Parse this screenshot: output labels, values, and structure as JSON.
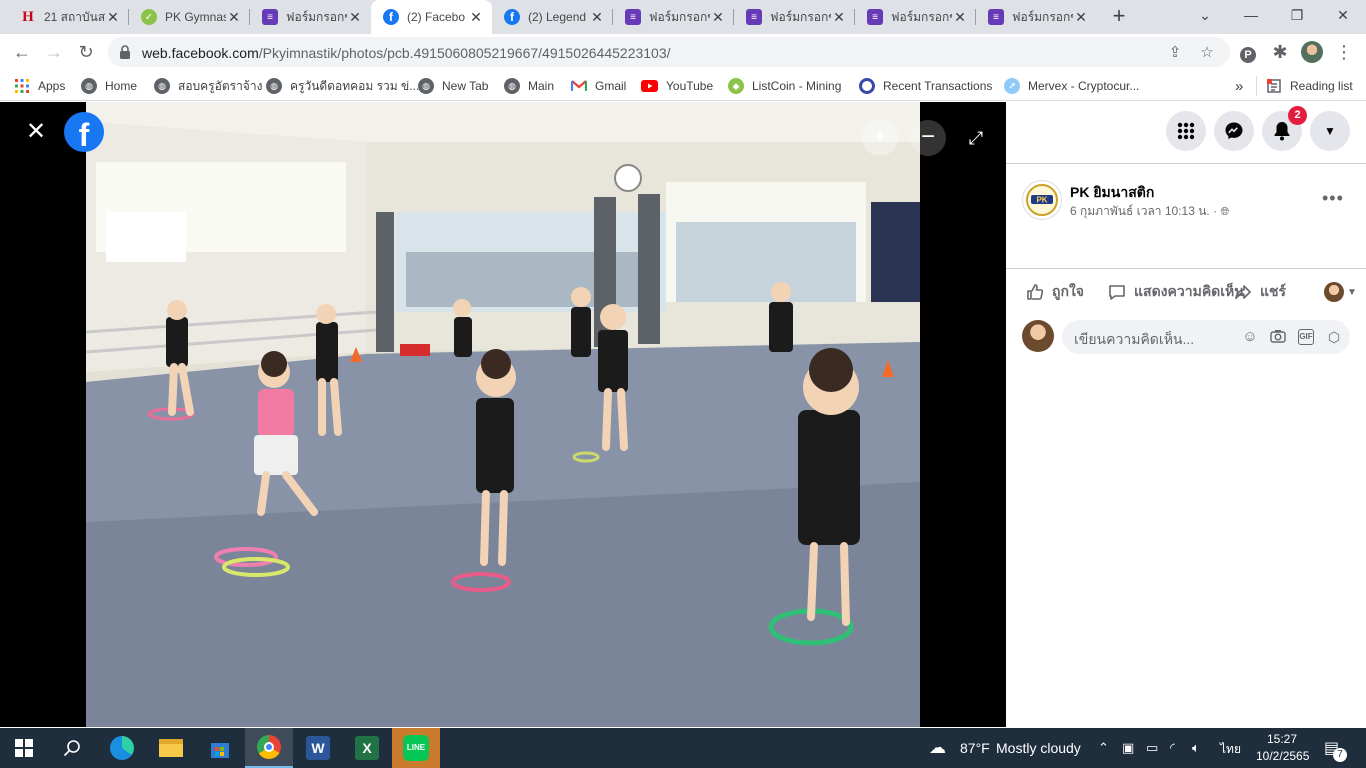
{
  "browser": {
    "tabs": [
      {
        "title": "21 สถาบันส",
        "favicon": "netflix-icon",
        "active": false
      },
      {
        "title": "PK Gymnas",
        "favicon": "pk-logo-icon",
        "active": false
      },
      {
        "title": "ฟอร์มกรอกข",
        "favicon": "forms-icon",
        "active": false
      },
      {
        "title": "(2) Facebo",
        "favicon": "facebook-icon",
        "active": true
      },
      {
        "title": "(2) Legend",
        "favicon": "facebook-icon",
        "active": false
      },
      {
        "title": "ฟอร์มกรอกข",
        "favicon": "forms-icon",
        "active": false
      },
      {
        "title": "ฟอร์มกรอกข",
        "favicon": "forms-icon",
        "active": false
      },
      {
        "title": "ฟอร์มกรอกข",
        "favicon": "forms-icon",
        "active": false
      },
      {
        "title": "ฟอร์มกรอกข",
        "favicon": "forms-icon",
        "active": false
      }
    ],
    "url_host": "web.facebook.com",
    "url_path": "/Pkyimnastik/photos/pcb.4915060805219667/4915026445223103/",
    "bookmarks": [
      {
        "label": "Apps",
        "icon": "apps-grid-icon"
      },
      {
        "label": "Home",
        "icon": "globe-icon"
      },
      {
        "label": "สอบครูอัตราจ้าง",
        "icon": "globe-icon"
      },
      {
        "label": "ครูวันดีดอทคอม รวม ข่...",
        "icon": "globe-icon"
      },
      {
        "label": "New Tab",
        "icon": "globe-icon"
      },
      {
        "label": "Main",
        "icon": "globe-icon"
      },
      {
        "label": "Gmail",
        "icon": "gmail-icon"
      },
      {
        "label": "YouTube",
        "icon": "youtube-icon"
      },
      {
        "label": "ListCoin - Mining",
        "icon": "listcoin-icon"
      },
      {
        "label": "Recent Transactions",
        "icon": "transactions-icon"
      },
      {
        "label": "Mervex - Cryptocur...",
        "icon": "mervex-icon"
      }
    ],
    "more_bookmarks": "»",
    "reading_list": "Reading list"
  },
  "viewer": {
    "close": "✕",
    "zoom_in": "+",
    "zoom_out": "−"
  },
  "post": {
    "page_name": "PK ยิมนาสติก",
    "date": "6 กุมภาพันธ์ เวลา 10:13 น. ·",
    "more": "•••",
    "notification_count": "2",
    "actions": {
      "like": "ถูกใจ",
      "comment": "แสดงความคิดเห็น",
      "share": "แชร์"
    },
    "comment_placeholder": "เขียนความคิดเห็น...",
    "comment_icons": [
      "emoji-icon",
      "camera-icon",
      "gif-icon",
      "sticker-icon"
    ],
    "gif_label": "GIF"
  },
  "taskbar": {
    "weather_temp": "87°F",
    "weather_text": "Mostly cloudy",
    "language": "ไทย",
    "time": "15:27",
    "date": "10/2/2565",
    "notifications": "7"
  }
}
